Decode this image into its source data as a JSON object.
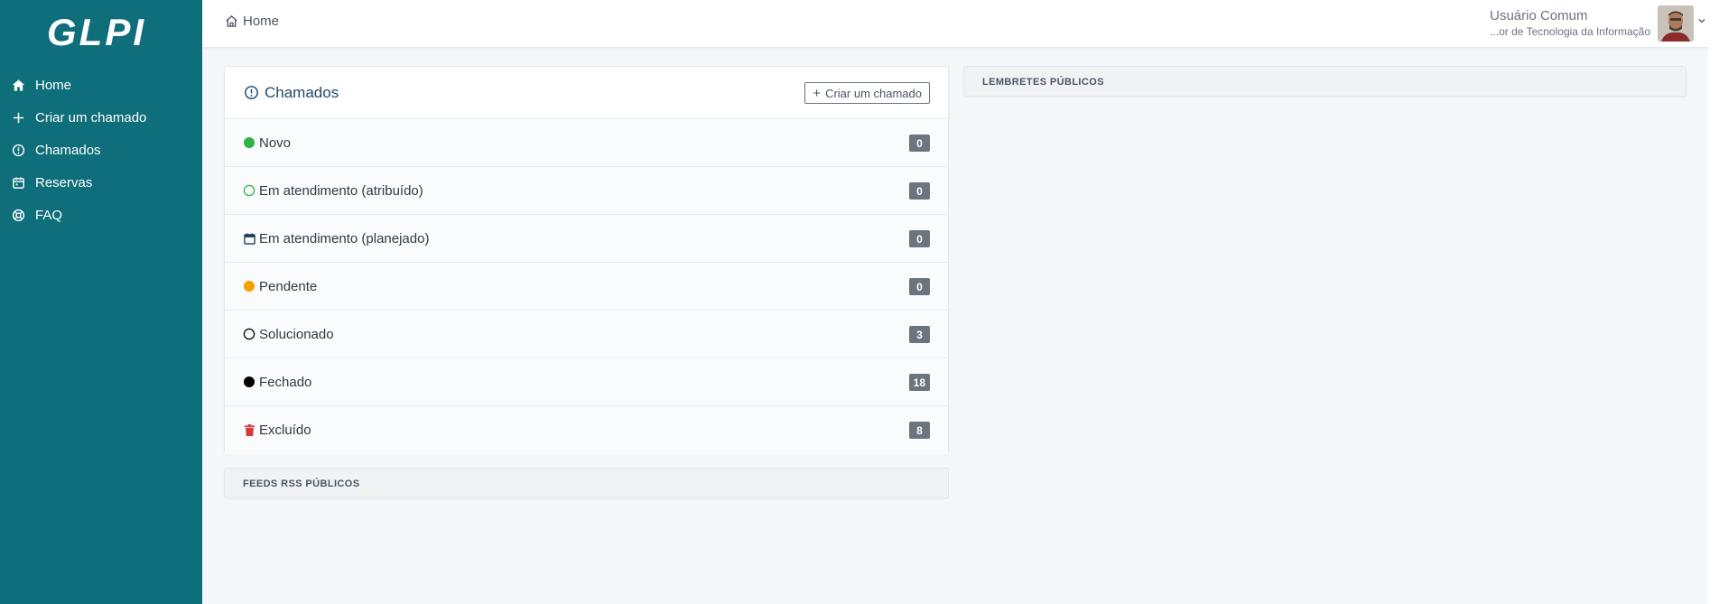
{
  "app": {
    "logo_text": "GLPI"
  },
  "sidebar": {
    "items": [
      {
        "label": "Home",
        "icon": "home-icon"
      },
      {
        "label": "Criar um chamado",
        "icon": "plus-icon"
      },
      {
        "label": "Chamados",
        "icon": "alert-circle-icon"
      },
      {
        "label": "Reservas",
        "icon": "calendar-icon"
      },
      {
        "label": "FAQ",
        "icon": "lifebuoy-icon"
      }
    ]
  },
  "topbar": {
    "breadcrumb": "Home",
    "user": {
      "name": "Usuário Comum",
      "entity": "...or de Tecnologia da Informação"
    }
  },
  "tickets_card": {
    "title": "Chamados",
    "create_button": "Criar um chamado",
    "statuses": [
      {
        "label": "Novo",
        "count": "0",
        "icon": "filled-green-circle-icon",
        "color": "#2fb344"
      },
      {
        "label": "Em atendimento (atribuído)",
        "count": "0",
        "icon": "outline-green-circle-icon",
        "color": "#2fb344"
      },
      {
        "label": "Em atendimento (planejado)",
        "count": "0",
        "icon": "calendar-icon",
        "color": "#1d3557"
      },
      {
        "label": "Pendente",
        "count": "0",
        "icon": "filled-orange-circle-icon",
        "color": "#f59f00"
      },
      {
        "label": "Solucionado",
        "count": "3",
        "icon": "outline-black-circle-icon",
        "color": "#000000"
      },
      {
        "label": "Fechado",
        "count": "18",
        "icon": "filled-black-circle-icon",
        "color": "#000000"
      },
      {
        "label": "Excluído",
        "count": "8",
        "icon": "trash-icon",
        "color": "#d63939"
      }
    ]
  },
  "rss_card": {
    "title": "FEEDS RSS PÚBLICOS"
  },
  "reminders_card": {
    "title": "LEMBRETES PÚBLICOS"
  },
  "colors": {
    "sidebar_bg": "#0e6e79",
    "page_bg": "#f5f7fb",
    "badge_bg": "#6c757d"
  }
}
